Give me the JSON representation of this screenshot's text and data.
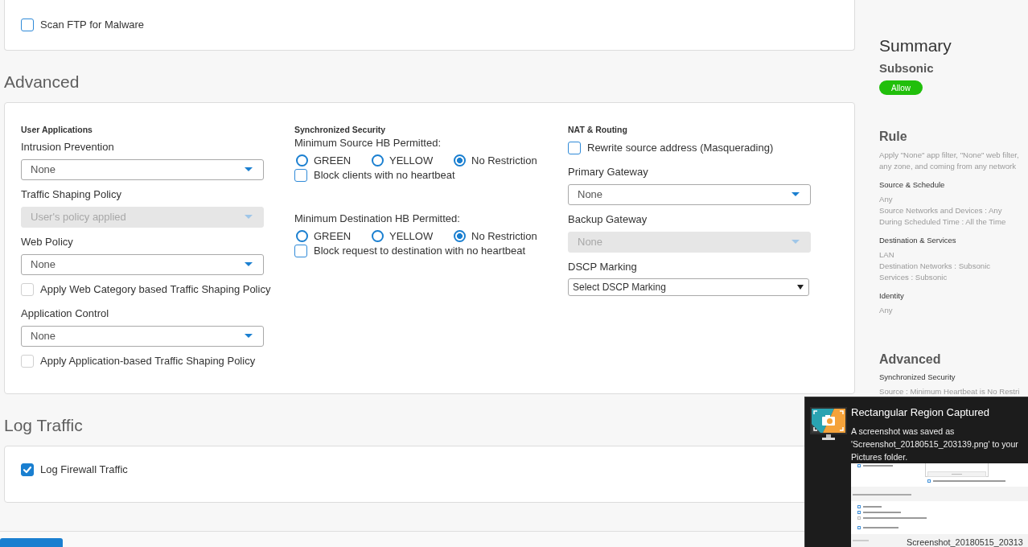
{
  "top_card": {
    "checkboxes": [
      {
        "label": "Scan FTP for Malware",
        "checked": false,
        "disabled": false
      }
    ]
  },
  "advanced": {
    "title": "Advanced",
    "columns": [
      {
        "heading": "User Applications",
        "fields": [
          {
            "kind": "select",
            "label": "Intrusion Prevention",
            "value": "None",
            "disabled": false
          },
          {
            "kind": "select",
            "label": "Traffic Shaping Policy",
            "value": "User's policy applied",
            "disabled": true
          },
          {
            "kind": "select",
            "label": "Web Policy",
            "value": "None",
            "disabled": false
          },
          {
            "kind": "checkbox",
            "label": "Apply Web Category based Traffic Shaping Policy",
            "checked": false,
            "disabled": true
          },
          {
            "kind": "select",
            "label": "Application Control",
            "value": "None",
            "disabled": false
          },
          {
            "kind": "checkbox",
            "label": "Apply Application-based Traffic Shaping Policy",
            "checked": false,
            "disabled": true
          }
        ]
      },
      {
        "heading": "Synchronized Security",
        "fields": [
          {
            "kind": "radio_group",
            "label": "Minimum Source HB Permitted:",
            "options": [
              {
                "label": "GREEN",
                "selected": false
              },
              {
                "label": "YELLOW",
                "selected": false
              },
              {
                "label": "No Restriction",
                "selected": true
              }
            ]
          },
          {
            "kind": "checkbox",
            "label": "Block clients with no heartbeat",
            "checked": false,
            "disabled": false
          },
          {
            "kind": "radio_group",
            "label": "Minimum Destination HB Permitted:",
            "options": [
              {
                "label": "GREEN",
                "selected": false
              },
              {
                "label": "YELLOW",
                "selected": false
              },
              {
                "label": "No Restriction",
                "selected": true
              }
            ]
          },
          {
            "kind": "checkbox",
            "label": "Block request to destination with no heartbeat",
            "checked": false,
            "disabled": false
          }
        ]
      },
      {
        "heading": "NAT & Routing",
        "fields": [
          {
            "kind": "checkbox",
            "label": "Rewrite source address (Masquerading)",
            "checked": false,
            "disabled": false
          },
          {
            "kind": "select",
            "label": "Primary Gateway",
            "value": "None",
            "disabled": false
          },
          {
            "kind": "select",
            "label": "Backup Gateway",
            "value": "None",
            "disabled": true
          },
          {
            "kind": "native_select",
            "label": "DSCP Marking",
            "value": "Select DSCP Marking"
          }
        ]
      }
    ]
  },
  "log_traffic": {
    "title": "Log Traffic",
    "checkboxes": [
      {
        "label": "Log Firewall Traffic",
        "checked": true,
        "disabled": false
      }
    ]
  },
  "summary": {
    "title": "Summary",
    "rule_name": "Subsonic",
    "action": "Allow",
    "sections": [
      {
        "title": "Rule",
        "description": [
          "Apply \"None\" app filter, \"None\" web filter,",
          "any zone, and coming from any network"
        ],
        "groups": [
          {
            "heading": "Source & Schedule",
            "lines": [
              "Any",
              "Source Networks and Devices : Any",
              "During Scheduled Time : All the Time"
            ]
          },
          {
            "heading": "Destination & Services",
            "lines": [
              "LAN",
              "Destination Networks : Subsonic",
              "Services : Subsonic"
            ]
          },
          {
            "heading": "Identity",
            "lines": [
              "Any"
            ]
          }
        ]
      },
      {
        "title": "Advanced",
        "groups": [
          {
            "heading": "Synchronized Security",
            "lines": [
              "Source : Minimum Heartbeat is No Restri"
            ]
          }
        ]
      }
    ]
  },
  "notification": {
    "title": "Rectangular Region Captured",
    "body": [
      "A screenshot was saved as",
      "'Screenshot_20180515_203139.png' to your",
      "Pictures folder."
    ],
    "caption": "Screenshot_20180515_20313"
  }
}
